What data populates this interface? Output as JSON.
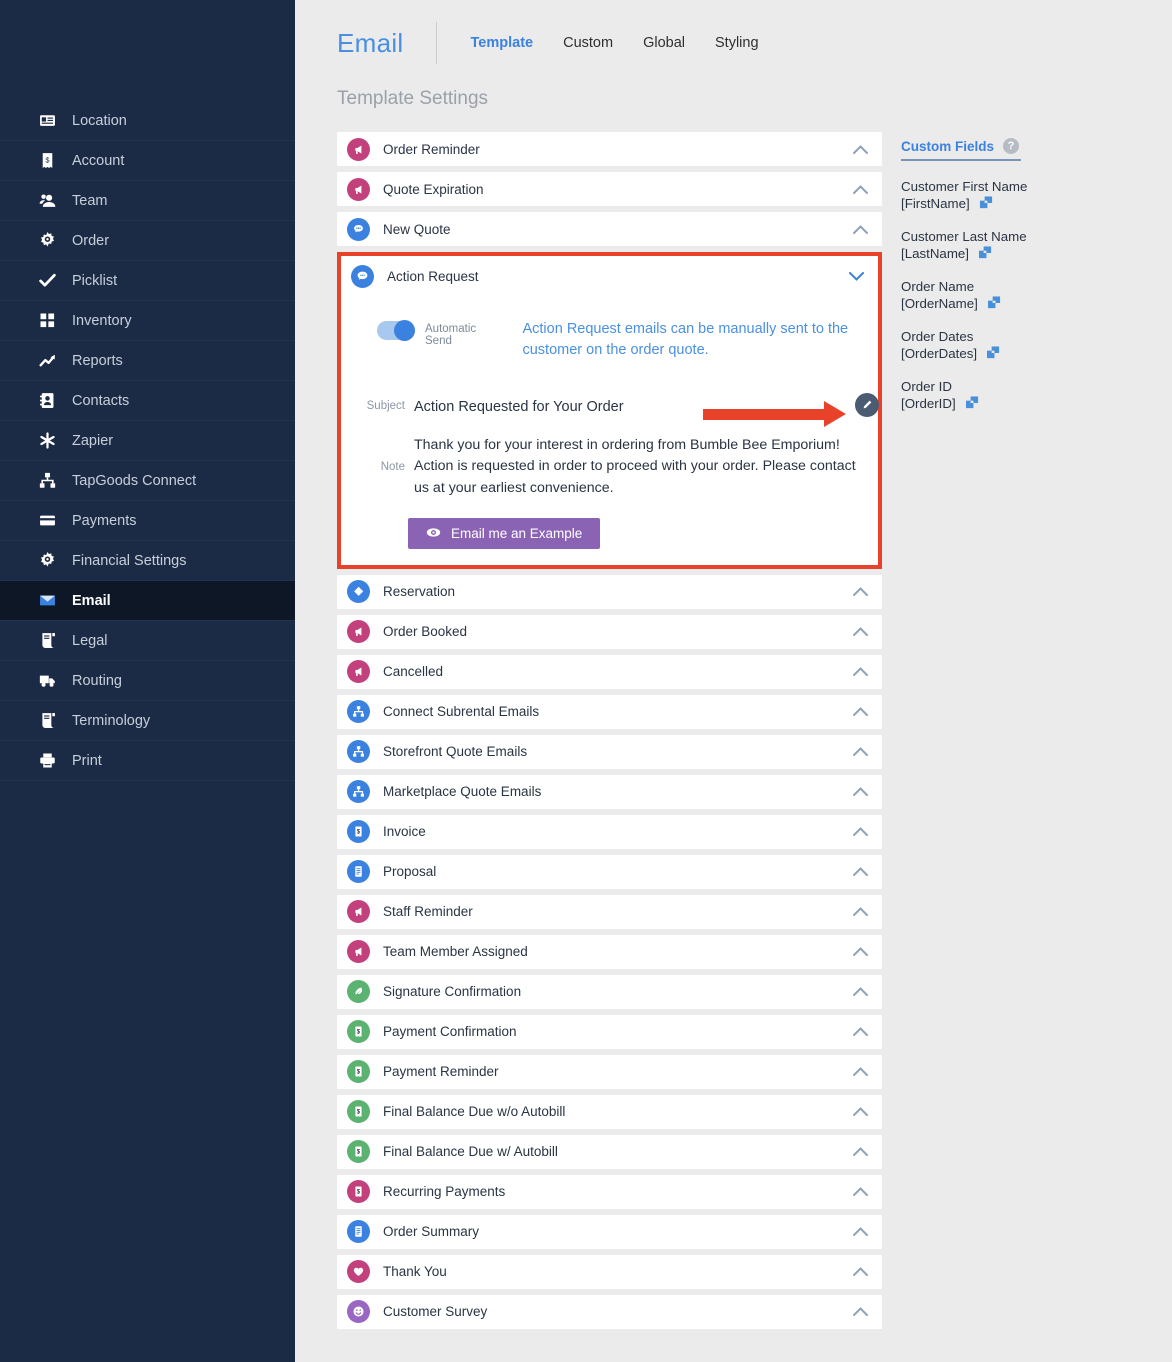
{
  "sidebar": {
    "items": [
      {
        "label": "Location",
        "icon": "id-card-icon",
        "active": false
      },
      {
        "label": "Account",
        "icon": "receipt-icon",
        "active": false
      },
      {
        "label": "Team",
        "icon": "users-icon",
        "active": false
      },
      {
        "label": "Order",
        "icon": "gear-icon",
        "active": false
      },
      {
        "label": "Picklist",
        "icon": "check-icon",
        "active": false
      },
      {
        "label": "Inventory",
        "icon": "grid-icon",
        "active": false
      },
      {
        "label": "Reports",
        "icon": "trending-up-icon",
        "active": false
      },
      {
        "label": "Contacts",
        "icon": "contact-book-icon",
        "active": false
      },
      {
        "label": "Zapier",
        "icon": "asterisk-icon",
        "active": false
      },
      {
        "label": "TapGoods Connect",
        "icon": "sitemap-icon",
        "active": false
      },
      {
        "label": "Payments",
        "icon": "credit-card-icon",
        "active": false
      },
      {
        "label": "Financial Settings",
        "icon": "gear-icon",
        "active": false
      },
      {
        "label": "Email",
        "icon": "envelope-icon",
        "active": true
      },
      {
        "label": "Legal",
        "icon": "scroll-icon",
        "active": false
      },
      {
        "label": "Routing",
        "icon": "truck-icon",
        "active": false
      },
      {
        "label": "Terminology",
        "icon": "scroll-icon",
        "active": false
      },
      {
        "label": "Print",
        "icon": "printer-icon",
        "active": false
      }
    ]
  },
  "header": {
    "title": "Email",
    "tabs": [
      {
        "label": "Template",
        "active": true
      },
      {
        "label": "Custom",
        "active": false
      },
      {
        "label": "Global",
        "active": false
      },
      {
        "label": "Styling",
        "active": false
      }
    ],
    "section_title": "Template Settings"
  },
  "templates_before": [
    {
      "label": "Order Reminder",
      "icon": "megaphone-icon",
      "color": "#c2407c"
    },
    {
      "label": "Quote Expiration",
      "icon": "megaphone-icon",
      "color": "#c2407c"
    },
    {
      "label": "New Quote",
      "icon": "comment-icon",
      "color": "#3b82e0"
    }
  ],
  "expanded": {
    "label": "Action Request",
    "icon": "comment-icon",
    "color": "#3b82e0",
    "toggle_label": "Automatic Send",
    "toggle_on": true,
    "hint": "Action Request emails can be manually sent to the customer on the order quote.",
    "subject_key": "Subject",
    "subject_value": "Action Requested for Your Order",
    "note_key": "Note",
    "note_value": "Thank you for your interest in ordering from Bumble Bee Emporium! Action is requested in order to proceed with your order. Please contact us at your earliest convenience.",
    "example_button": "Email me an Example",
    "highlight_color": "#e8432a",
    "button_color": "#8b63b5"
  },
  "templates_after": [
    {
      "label": "Reservation",
      "icon": "tag-icon",
      "color": "#3b82e0"
    },
    {
      "label": "Order Booked",
      "icon": "megaphone-icon",
      "color": "#c2407c"
    },
    {
      "label": "Cancelled",
      "icon": "megaphone-icon",
      "color": "#c2407c"
    },
    {
      "label": "Connect Subrental Emails",
      "icon": "sitemap-icon",
      "color": "#3b82e0"
    },
    {
      "label": "Storefront Quote Emails",
      "icon": "sitemap-icon",
      "color": "#3b82e0"
    },
    {
      "label": "Marketplace Quote Emails",
      "icon": "sitemap-icon",
      "color": "#3b82e0"
    },
    {
      "label": "Invoice",
      "icon": "money-icon",
      "color": "#3b82e0"
    },
    {
      "label": "Proposal",
      "icon": "document-icon",
      "color": "#3b82e0"
    },
    {
      "label": "Staff Reminder",
      "icon": "megaphone-icon",
      "color": "#c2407c"
    },
    {
      "label": "Team Member Assigned",
      "icon": "megaphone-icon",
      "color": "#c2407c"
    },
    {
      "label": "Signature Confirmation",
      "icon": "pen-icon",
      "color": "#5cb270"
    },
    {
      "label": "Payment Confirmation",
      "icon": "money-icon",
      "color": "#5cb270"
    },
    {
      "label": "Payment Reminder",
      "icon": "money-icon",
      "color": "#5cb270"
    },
    {
      "label": "Final Balance Due w/o Autobill",
      "icon": "money-icon",
      "color": "#5cb270"
    },
    {
      "label": "Final Balance Due w/ Autobill",
      "icon": "money-icon",
      "color": "#5cb270"
    },
    {
      "label": "Recurring Payments",
      "icon": "money-icon",
      "color": "#c2407c"
    },
    {
      "label": "Order Summary",
      "icon": "document-icon",
      "color": "#3b82e0"
    },
    {
      "label": "Thank You",
      "icon": "heart-icon",
      "color": "#c2407c"
    },
    {
      "label": "Customer Survey",
      "icon": "smiley-icon",
      "color": "#9966c4"
    }
  ],
  "custom_fields": {
    "title": "Custom Fields",
    "help": "?",
    "items": [
      {
        "name": "Customer First Name",
        "token": "[FirstName]"
      },
      {
        "name": "Customer Last Name",
        "token": "[LastName]"
      },
      {
        "name": "Order Name",
        "token": "[OrderName]"
      },
      {
        "name": "Order Dates",
        "token": "[OrderDates]"
      },
      {
        "name": "Order ID",
        "token": "[OrderID]"
      }
    ]
  }
}
